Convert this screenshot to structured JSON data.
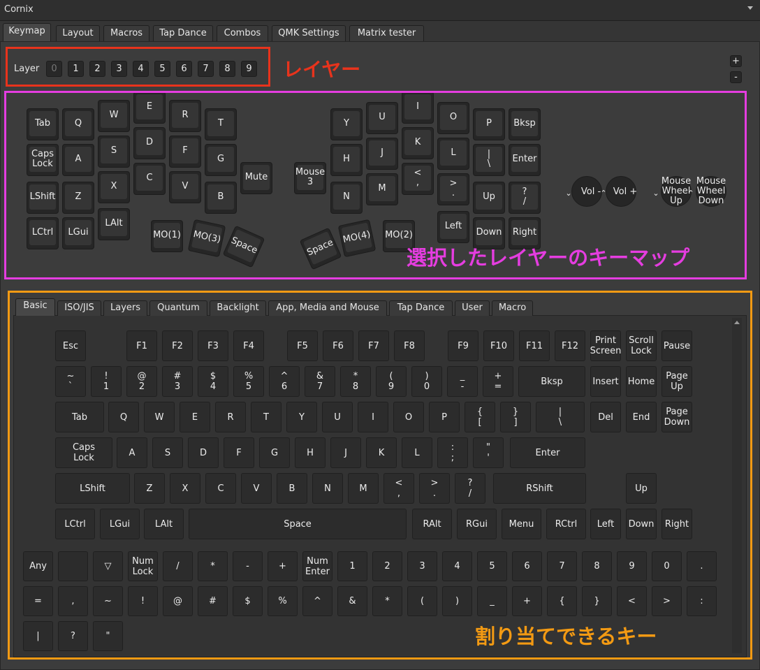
{
  "app": {
    "title": "Cornix"
  },
  "main_tabs": [
    "Keymap",
    "Layout",
    "Macros",
    "Tap Dance",
    "Combos",
    "QMK Settings",
    "Matrix tester"
  ],
  "layer": {
    "label": "Layer",
    "buttons": [
      "0",
      "1",
      "2",
      "3",
      "4",
      "5",
      "6",
      "7",
      "8",
      "9"
    ],
    "plus": "+",
    "minus": "-"
  },
  "keymap_keys": [
    "Tab",
    "Q",
    "W",
    "E",
    "R",
    "T",
    "Caps\nLock",
    "A",
    "S",
    "D",
    "F",
    "G",
    "LShift",
    "Z",
    "X",
    "C",
    "V",
    "B",
    "LCtrl",
    "LGui",
    "LAlt",
    "Mute",
    "MO(1)",
    "MO(3)",
    "Space",
    "Mouse\n3",
    "Y",
    "U",
    "I",
    "O",
    "P",
    "Bksp",
    "H",
    "J",
    "K",
    "L",
    "|\n\\",
    "Enter",
    "N",
    "M",
    "<\n,",
    ">\n.",
    "Up",
    "?\n/",
    "Left",
    "Down",
    "Right",
    "Space",
    "MO(4)",
    "MO(2)"
  ],
  "encoders": [
    "Vol -",
    "Vol +",
    "Mouse\nWheel\nUp",
    "Mouse\nWheel\nDown"
  ],
  "key_tabs": [
    "Basic",
    "ISO/JIS",
    "Layers",
    "Quantum",
    "Backlight",
    "App, Media and Mouse",
    "Tap Dance",
    "User",
    "Macro"
  ],
  "keyboard_keys": [
    "Esc",
    "F1",
    "F2",
    "F3",
    "F4",
    "F5",
    "F6",
    "F7",
    "F8",
    "F9",
    "F10",
    "F11",
    "F12",
    "Print\nScreen",
    "Scroll\nLock",
    "Pause",
    "~\n`",
    "!\n1",
    "@\n2",
    "#\n3",
    "$\n4",
    "%\n5",
    "^\n6",
    "&\n7",
    "*\n8",
    "(\n9",
    ")\n0",
    "_\n-",
    "+\n=",
    "Bksp",
    "Insert",
    "Home",
    "Page\nUp",
    "Tab",
    "Q",
    "W",
    "E",
    "R",
    "T",
    "Y",
    "U",
    "I",
    "O",
    "P",
    "{\n[",
    "}\n]",
    "|\n\\",
    "Del",
    "End",
    "Page\nDown",
    "Caps\nLock",
    "A",
    "S",
    "D",
    "F",
    "G",
    "H",
    "J",
    "K",
    "L",
    ":\n;",
    "\"\n'",
    "Enter",
    "LShift",
    "Z",
    "X",
    "C",
    "V",
    "B",
    "N",
    "M",
    "<\n,",
    ">\n.",
    "?\n/",
    "RShift",
    "Up",
    "LCtrl",
    "LGui",
    "LAlt",
    "Space",
    "RAlt",
    "RGui",
    "Menu",
    "RCtrl",
    "Left",
    "Down",
    "Right"
  ],
  "extra_keys": [
    "Any",
    "",
    "▽",
    "Num\nLock",
    "/",
    "*",
    "-",
    "+",
    "Num\nEnter",
    "1",
    "2",
    "3",
    "4",
    "5",
    "6",
    "7",
    "8",
    "9",
    "0",
    ".",
    "=",
    ",",
    "~",
    "!",
    "@",
    "#",
    "$",
    "%",
    "^",
    "&",
    "*",
    "(",
    ")",
    "_",
    "+",
    "{",
    "}",
    "<",
    ">",
    ":",
    "|",
    "?",
    "\""
  ],
  "annotations": {
    "layer": "レイヤー",
    "keymap": "選択したレイヤーのキーマップ",
    "assignable": "割り当てできるキー"
  },
  "colors": {
    "red": "#e8331c",
    "magenta": "#e53de0",
    "orange": "#f39a13"
  }
}
